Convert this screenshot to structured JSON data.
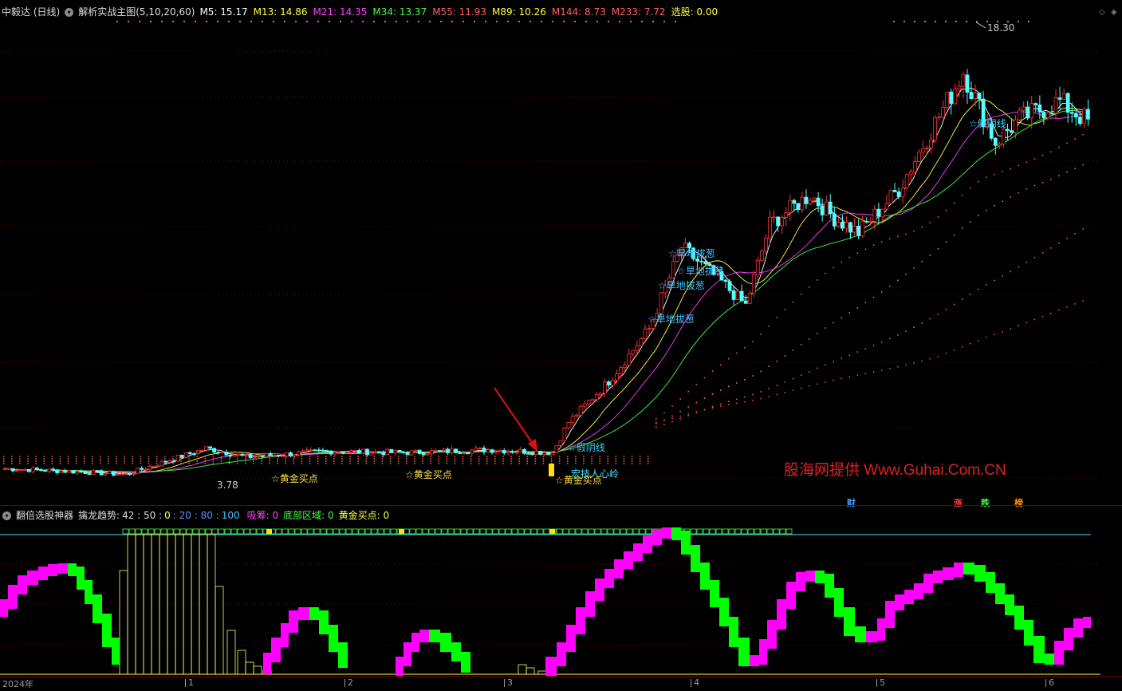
{
  "main_legend": {
    "stock": "中毅达 (日线)",
    "indicator": "解析实战主图(5,10,20,60)",
    "ma": [
      {
        "label": "M5: 15.17",
        "color": "#ffffff"
      },
      {
        "label": "M13: 14.86",
        "color": "#ffff40"
      },
      {
        "label": "M21: 14.35",
        "color": "#ff40ff"
      },
      {
        "label": "M34: 13.37",
        "color": "#40ff40"
      },
      {
        "label": "M55: 11.93",
        "color": "#ff6060"
      },
      {
        "label": "M89: 10.26",
        "color": "#ffff40"
      },
      {
        "label": "M144: 8.73",
        "color": "#ff6060"
      },
      {
        "label": "M233: 7.72",
        "color": "#ff6060"
      },
      {
        "label": "选股: 0.00",
        "color": "#ffff40"
      }
    ]
  },
  "price_labels": {
    "high": "18.30",
    "low": "3.78"
  },
  "annotations": {
    "gold_buy": "☆黄金买点",
    "hanba": "☆旱地拔葱",
    "fake_yin": "☆假阴线",
    "stem": "宏技人心岭"
  },
  "watermark": "股海网提供 Www.Guhai.Com.CN",
  "tags": [
    {
      "text": "财",
      "color": "#4aa0ff"
    },
    {
      "text": "涨",
      "color": "#ff4040"
    },
    {
      "text": "跌",
      "color": "#40ff40"
    },
    {
      "text": "榜",
      "color": "#ff9000"
    }
  ],
  "sub_legend": {
    "name": "翻倍选股神器",
    "trend_label": "擒龙趋势:",
    "trend_values": [
      {
        "text": "42 : 50 :",
        "color": "#dddddd"
      },
      {
        "text": "0",
        "color": "#ffff40"
      },
      {
        "text": ": 20 : 80 :",
        "color": "#6090ff"
      },
      {
        "text": "100",
        "color": "#40c0ff"
      }
    ],
    "items": [
      {
        "text": "吸筹: 0",
        "color": "#ff40ff"
      },
      {
        "text": "底部区域: 0",
        "color": "#40ff40"
      },
      {
        "text": "黄金买点: 0",
        "color": "#ffff40"
      }
    ]
  },
  "x_axis": [
    {
      "label": "2024年",
      "pos": 3
    },
    {
      "label": "1",
      "pos": 236
    },
    {
      "label": "2",
      "pos": 436
    },
    {
      "label": "3",
      "pos": 636
    },
    {
      "label": "4",
      "pos": 870
    },
    {
      "label": "5",
      "pos": 1103
    },
    {
      "label": "6",
      "pos": 1315
    }
  ],
  "colors": {
    "up": "#ff3030",
    "down": "#54ffff",
    "grid": "#7a0000",
    "macross_up": "#ff00ff",
    "macross_down": "#00ff00"
  }
}
